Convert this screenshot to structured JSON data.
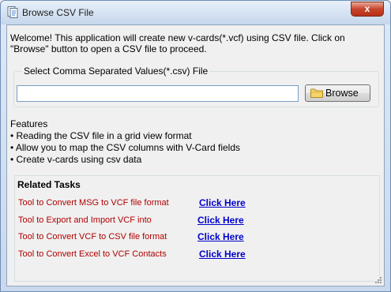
{
  "window": {
    "title": "Browse CSV File",
    "close_label": "x"
  },
  "welcome_text": "Welcome! This application will create new v-cards(*.vcf) using CSV file. Click on \"Browse\" button to open a CSV file to proceed.",
  "file_group": {
    "legend": "Select Comma Separated Values(*.csv)  File",
    "path_value": "",
    "browse_label": "Browse"
  },
  "features": {
    "heading": "Features",
    "items": [
      "• Reading the CSV file in a grid view format",
      "• Allow you to map the CSV columns with V-Card fields",
      "• Create v-cards using csv data"
    ]
  },
  "related_tasks": {
    "heading": "Related Tasks",
    "items": [
      {
        "label": "Tool to Convert MSG to VCF file format",
        "link": "Click Here"
      },
      {
        "label": "Tool to Export and Import VCF into",
        "link": "Click Here"
      },
      {
        "label": "Tool to Convert VCF to CSV file format",
        "link": "Click Here"
      },
      {
        "label": "Tool to Convert Excel to VCF Contacts",
        "link": "Click Here"
      }
    ]
  },
  "colors": {
    "task_text": "#b00000",
    "link": "#0000cc",
    "close_button": "#c7442b"
  }
}
